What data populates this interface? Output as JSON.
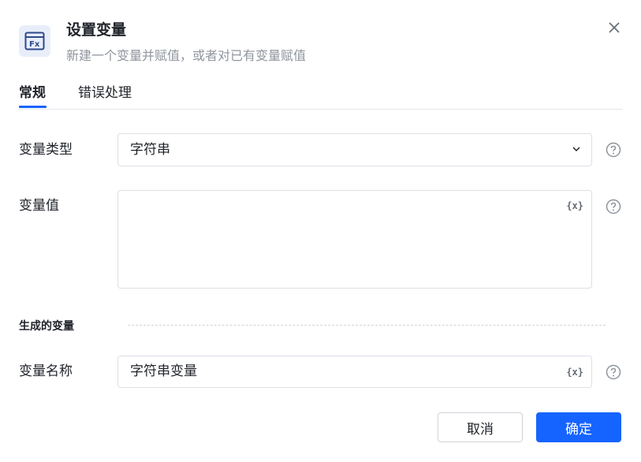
{
  "header": {
    "icon": "function-variable-icon",
    "title": "设置变量",
    "subtitle": "新建一个变量并赋值，或者对已有变量赋值",
    "close_icon": "close-icon"
  },
  "tabs": [
    {
      "label": "常规",
      "active": true
    },
    {
      "label": "错误处理",
      "active": false
    }
  ],
  "form": {
    "variable_type": {
      "label": "变量类型",
      "value": "字符串"
    },
    "variable_value": {
      "label": "变量值",
      "value": "",
      "var_button": "{x}"
    },
    "generated_section": {
      "title": "生成的变量"
    },
    "variable_name": {
      "label": "变量名称",
      "value": "字符串变量",
      "var_button": "{x}"
    }
  },
  "footer": {
    "cancel_label": "取消",
    "ok_label": "确定"
  },
  "colors": {
    "accent": "#1664ff",
    "icon_bg": "#e8eef9",
    "icon_fg": "#2f4a8a"
  }
}
